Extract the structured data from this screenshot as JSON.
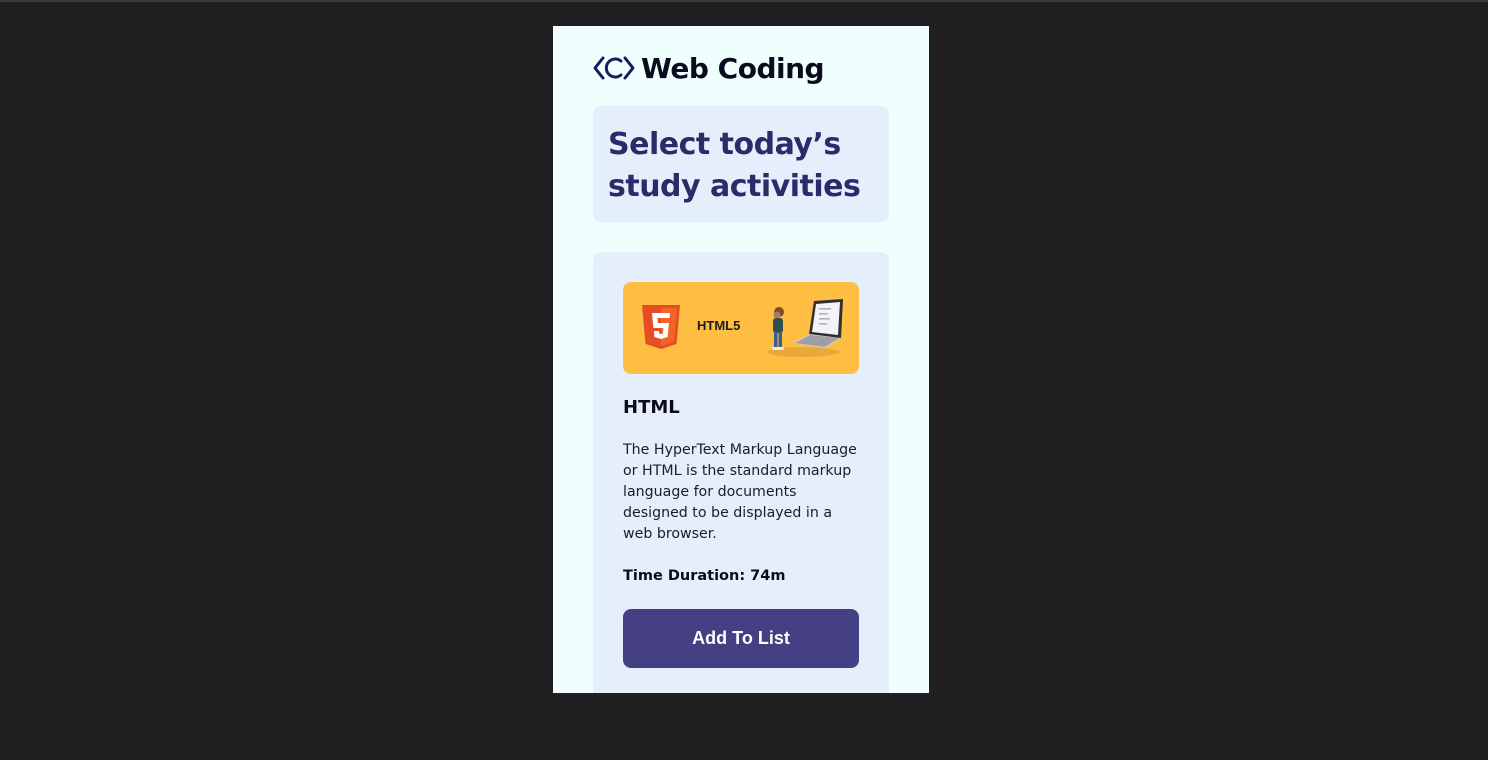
{
  "header": {
    "logo_icon": "code-c-logo-icon",
    "brand": "Web Coding"
  },
  "main": {
    "title": "Select today’s study activities"
  },
  "cards": [
    {
      "banner": {
        "icon": "html5-shield-icon",
        "label": "HTML5",
        "illustration": "person-with-laptop-illustration",
        "background": "#fdbe42"
      },
      "title": "HTML",
      "description": "The HyperText Markup Language or HTML is the standard markup language for documents designed to be displayed in a web browser.",
      "duration": "Time Duration: 74m",
      "button_label": "Add To List"
    }
  ],
  "colors": {
    "page_background": "#eefffe",
    "panel_background": "#e5effc",
    "title_color": "#2c2a68",
    "button_background": "#444083",
    "outer_background": "#202022"
  }
}
